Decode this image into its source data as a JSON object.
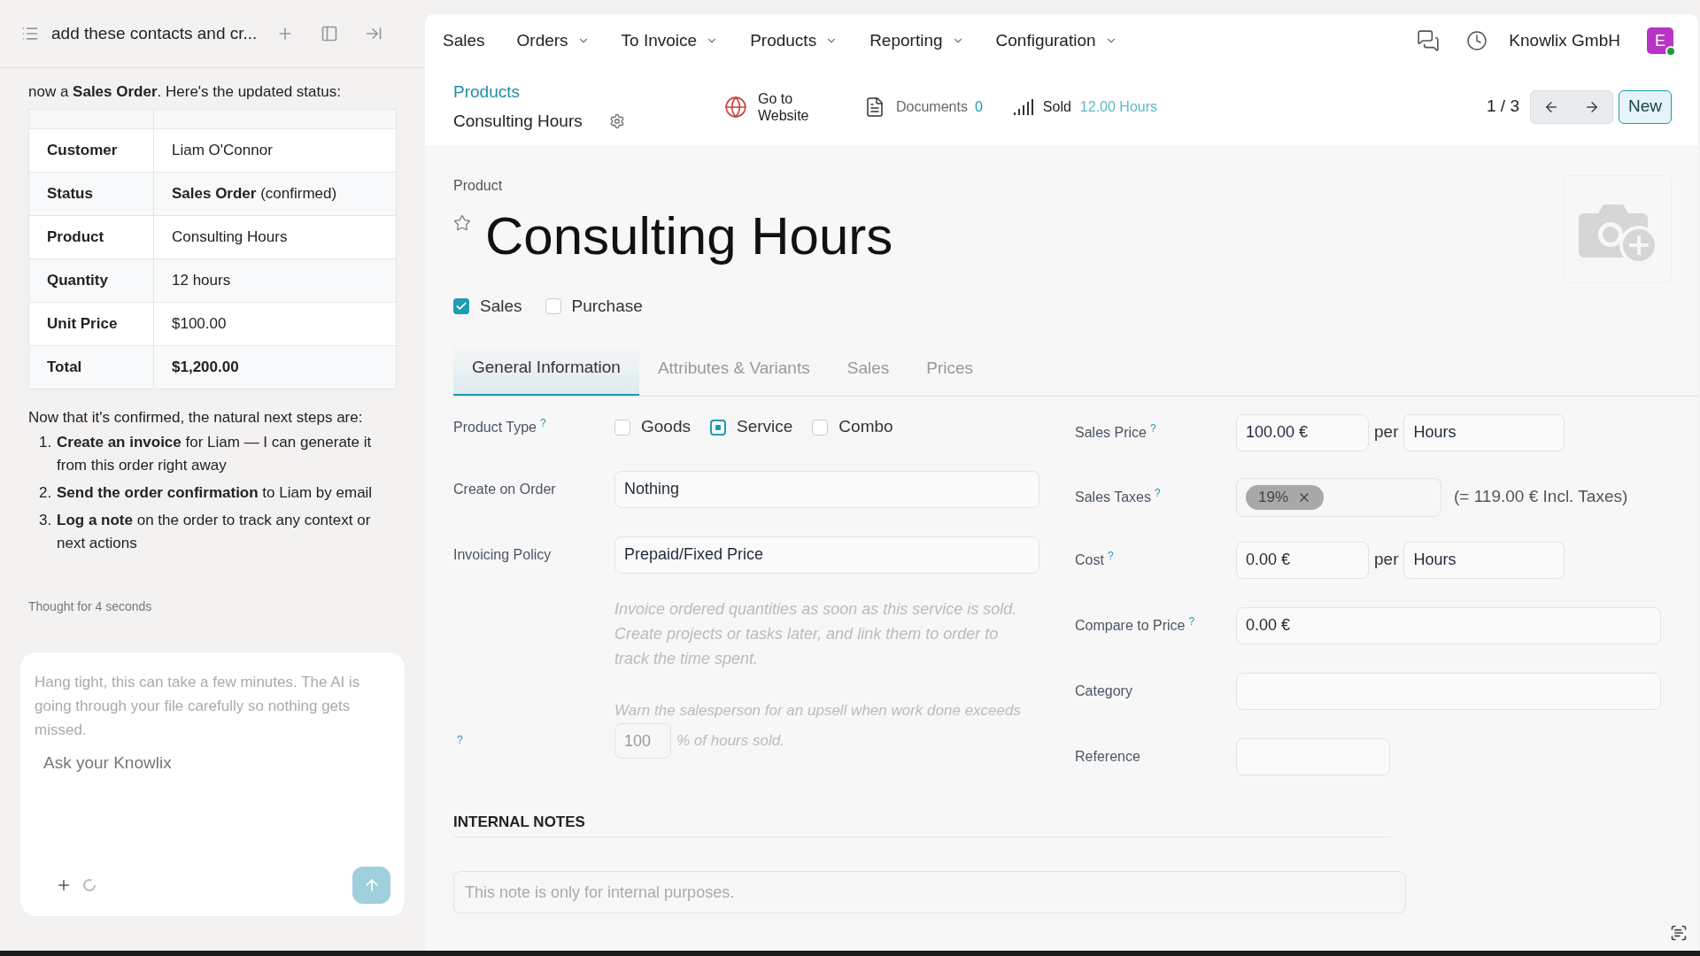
{
  "chat": {
    "title": "add these contacts and cr...",
    "intro": "now a **Sales Order**. Here's the updated status:",
    "table": {
      "rows": [
        {
          "label": "Customer",
          "value": "Liam O'Connor"
        },
        {
          "label": "Status",
          "value": "**Sales Order** (confirmed)"
        },
        {
          "label": "Product",
          "value": "Consulting Hours"
        },
        {
          "label": "Quantity",
          "value": "12 hours"
        },
        {
          "label": "Unit Price",
          "value": "$100.00"
        },
        {
          "label": "Total",
          "value": "**$1,200.00**"
        }
      ]
    },
    "outro": "Now that it's confirmed, the natural next steps are:",
    "steps": [
      {
        "number": "1.",
        "text": "**Create an invoice** for Liam — I can generate it from this order right away"
      },
      {
        "number": "2.",
        "text": "**Send the order confirmation** to Liam by email"
      },
      {
        "number": "3.",
        "text": "**Log a note** on the order to track any context or next actions"
      }
    ],
    "thought": "Thought for 4 seconds",
    "status": "Hang tight, this can take a few minutes. The AI is going through your file carefully so nothing gets missed.",
    "input": {
      "placeholder": "Ask your Knowlix"
    }
  },
  "nav": {
    "items": [
      {
        "label": "Sales",
        "dropdown": false
      },
      {
        "label": "Orders",
        "dropdown": true
      },
      {
        "label": "To Invoice",
        "dropdown": true
      },
      {
        "label": "Products",
        "dropdown": true
      },
      {
        "label": "Reporting",
        "dropdown": true
      },
      {
        "label": "Configuration",
        "dropdown": true
      }
    ],
    "company": "Knowlix GmbH",
    "avatar": "E"
  },
  "control_panel": {
    "breadcrumb": "Products",
    "record": "Consulting Hours",
    "go_to_website": "Go to Website",
    "documents": {
      "label": "Documents",
      "count": "0"
    },
    "sold": {
      "label": "Sold",
      "value": "12.00 Hours"
    },
    "pager": "1 / 3",
    "new_button": "New"
  },
  "form": {
    "caption": "Product",
    "title": "Consulting Hours",
    "checkboxes": [
      {
        "label": "Sales",
        "checked": true
      },
      {
        "label": "Purchase",
        "checked": false
      }
    ],
    "tabs": [
      {
        "label": "General Information",
        "selected": true
      },
      {
        "label": "Attributes & Variants",
        "selected": false
      },
      {
        "label": "Sales",
        "selected": false
      },
      {
        "label": "Prices",
        "selected": false
      }
    ],
    "product_type": {
      "label": "Product Type",
      "help": "?",
      "options": [
        {
          "label": "Goods",
          "selected": false
        },
        {
          "label": "Service",
          "selected": true
        },
        {
          "label": "Combo",
          "selected": false
        }
      ]
    },
    "create_on_order": {
      "label": "Create on Order",
      "value": "Nothing"
    },
    "invoicing_policy": {
      "label": "Invoicing Policy",
      "value": "Prepaid/Fixed Price"
    },
    "invoicing_hint": "Invoice ordered quantities as soon as this service is sold. Create projects or tasks later, and link them to order to track the time spent.",
    "upsell": {
      "help": "?",
      "before": "Warn the salesperson for an upsell when work done exceeds",
      "value": "100",
      "after": "% of hours sold."
    },
    "sales_price": {
      "label": "Sales Price",
      "help": "?",
      "value": "100.00 €",
      "per": "per",
      "unit": "Hours"
    },
    "sales_taxes": {
      "label": "Sales Taxes",
      "help": "?",
      "tags": [
        "19%"
      ],
      "note": "(= 119.00 € Incl. Taxes)"
    },
    "cost": {
      "label": "Cost",
      "help": "?",
      "value": "0.00 €",
      "per": "per",
      "unit": "Hours"
    },
    "compare_price": {
      "label": "Compare to Price",
      "help": "?",
      "value": "0.00 €"
    },
    "category": {
      "label": "Category"
    },
    "reference": {
      "label": "Reference"
    },
    "internal_notes": {
      "heading": "INTERNAL NOTES",
      "placeholder": "This note is only for internal purposes."
    }
  }
}
